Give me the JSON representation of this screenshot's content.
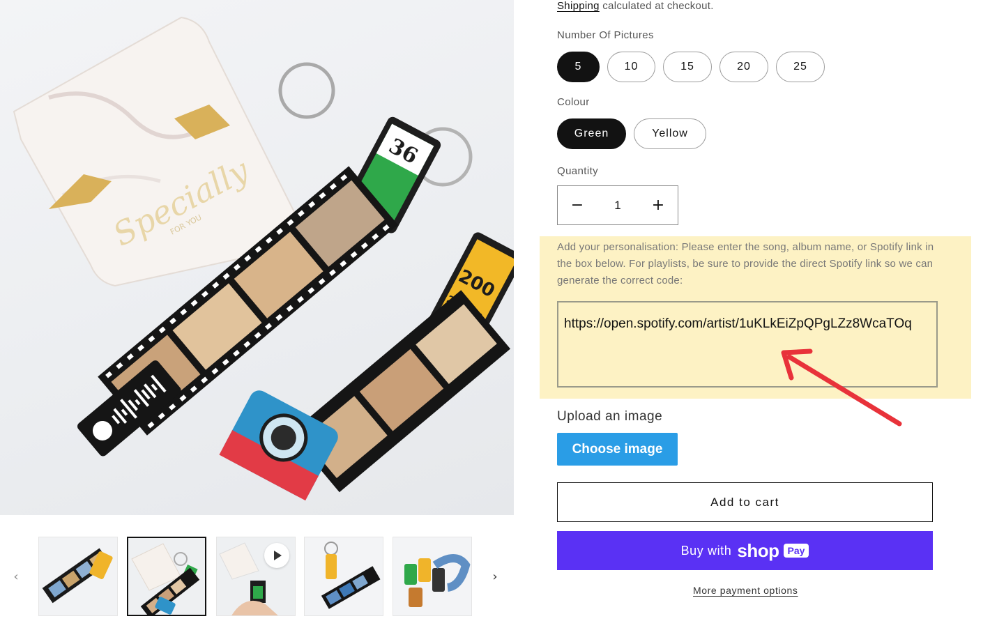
{
  "shipping": {
    "link_text": "Shipping",
    "suffix": " calculated at checkout."
  },
  "options": {
    "pictures": {
      "label": "Number Of Pictures",
      "values": [
        "5",
        "10",
        "15",
        "20",
        "25"
      ],
      "selected": "5"
    },
    "colour": {
      "label": "Colour",
      "values": [
        "Green",
        "Yellow"
      ],
      "selected": "Green"
    }
  },
  "quantity": {
    "label": "Quantity",
    "value": "1",
    "minus": "−",
    "plus": "+"
  },
  "personalisation": {
    "prompt": "Add your personalisation: Please enter the song, album name, or Spotify link in the box below. For playlists, be sure to provide the direct Spotify link so we can generate the correct code:",
    "value": "https://open.spotify.com/artist/1uKLkEiZpQPgLZz8WcaTOq",
    "highlight_color": "#fdf2c4",
    "arrow_color": "#e8323a"
  },
  "upload": {
    "label": "Upload an image",
    "button": "Choose image"
  },
  "buttons": {
    "add_to_cart": "Add to cart",
    "buy_with": "Buy with",
    "shop_logo": "shop",
    "pay_badge": "Pay",
    "more_payment": "More payment options"
  },
  "product_image": {
    "tag_card_script": "Specially",
    "tag_card_sub": "FOR YOU",
    "canister_green_number": "36",
    "canister_yellow_number": "200",
    "canister_yellow_exp": "24 exp."
  },
  "gallery": {
    "prev_icon": "‹",
    "next_icon": "›",
    "thumbnails": [
      {
        "name": "thumb-keychains-city",
        "active": false,
        "video": false
      },
      {
        "name": "thumb-gift-box",
        "active": true,
        "video": false
      },
      {
        "name": "thumb-video-hand",
        "active": false,
        "video": true
      },
      {
        "name": "thumb-keychain-blue",
        "active": false,
        "video": false
      },
      {
        "name": "thumb-canisters",
        "active": false,
        "video": false
      }
    ]
  },
  "colors": {
    "brand_shop": "#5a31f4",
    "choose_button": "#2a9de6",
    "selected_pill": "#121212"
  }
}
